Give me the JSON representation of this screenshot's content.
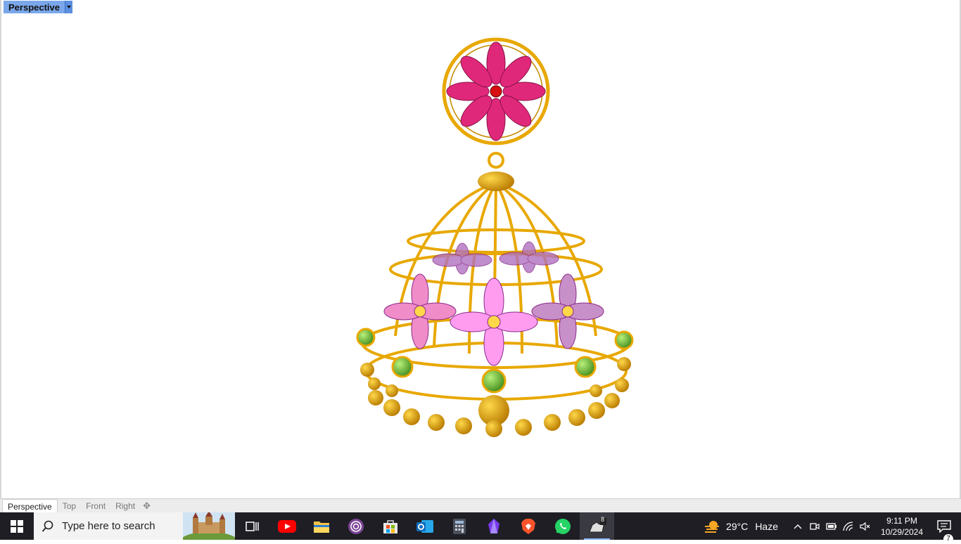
{
  "viewport": {
    "label": "Perspective"
  },
  "view_tabs": [
    "Perspective",
    "Top",
    "Front",
    "Right"
  ],
  "taskbar": {
    "search_placeholder": "Type here to search",
    "pinned": [
      "task-view-icon",
      "youtube-icon",
      "file-explorer-icon",
      "tor-browser-icon",
      "microsoft-store-icon",
      "outlook-icon",
      "calculator-icon",
      "obsidian-icon",
      "brave-icon",
      "whatsapp-icon",
      "rhino-8-icon"
    ],
    "rhino_badge": "8"
  },
  "tray": {
    "temperature": "29°C",
    "condition": "Haze",
    "time": "9:11 PM",
    "date": "10/29/2024",
    "notification_count": "7"
  },
  "colors": {
    "gold": "#e8a800",
    "pink": "#e0287a",
    "green": "#6cc23a",
    "accent": "#7aa7ea",
    "taskbar": "#1e1e24"
  }
}
